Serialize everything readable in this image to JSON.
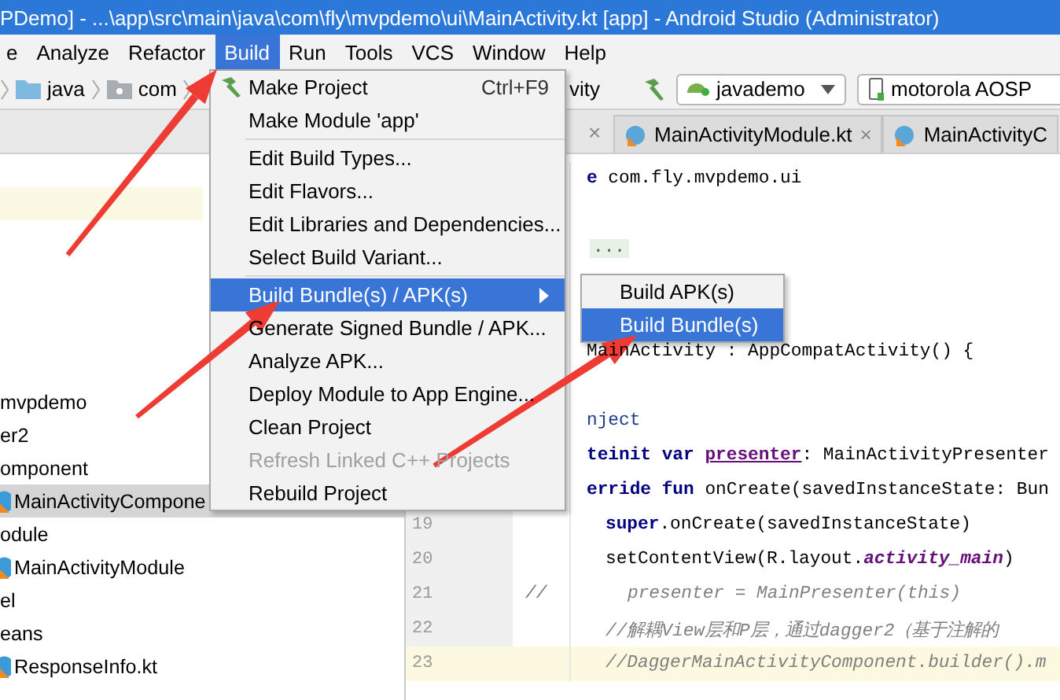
{
  "window": {
    "title": "PDemo] - ...\\app\\src\\main\\java\\com\\fly\\mvpdemo\\ui\\MainActivity.kt [app] - Android Studio (Administrator)"
  },
  "menu_bar": [
    {
      "label": "e",
      "selected": false
    },
    {
      "label": "Analyze",
      "selected": false
    },
    {
      "label": "Refactor",
      "selected": false
    },
    {
      "label": "Build",
      "selected": true
    },
    {
      "label": "Run",
      "selected": false
    },
    {
      "label": "Tools",
      "selected": false
    },
    {
      "label": "VCS",
      "selected": false
    },
    {
      "label": "Window",
      "selected": false
    },
    {
      "label": "Help",
      "selected": false
    }
  ],
  "toolbar": {
    "breadcrumbs": [
      {
        "label": "java",
        "kind": "source_folder"
      },
      {
        "label": "com",
        "kind": "package"
      }
    ],
    "breadcrumb_tail": "vity",
    "run_config": "javademo",
    "device": "motorola AOSP"
  },
  "project_tree": {
    "items": [
      {
        "label": "mvpdemo",
        "has_icon": false,
        "selected": false
      },
      {
        "label": "er2",
        "has_icon": false,
        "selected": false
      },
      {
        "label": "omponent",
        "has_icon": false,
        "selected": false
      },
      {
        "label": "MainActivityCompone",
        "has_icon": true,
        "selected": true
      },
      {
        "label": "odule",
        "has_icon": false,
        "selected": false
      },
      {
        "label": "MainActivityModule",
        "has_icon": true,
        "selected": false
      },
      {
        "label": "el",
        "has_icon": false,
        "selected": false
      },
      {
        "label": "eans",
        "has_icon": false,
        "selected": false
      },
      {
        "label": "ResponseInfo.kt",
        "has_icon": true,
        "selected": false
      }
    ]
  },
  "editor": {
    "hidden_tab_close": "×",
    "tabs": [
      {
        "label": "MainActivityModule.kt",
        "close": "×",
        "selected": false
      },
      {
        "label": "MainActivityC",
        "selected": false
      }
    ],
    "lines": [
      {
        "kind": "code",
        "highlighted": false,
        "segments": [
          {
            "text": "e ",
            "kind": "keyword"
          },
          {
            "text": "com.fly.mvpdemo.ui",
            "kind": "plain"
          }
        ]
      },
      {
        "kind": "blank",
        "highlighted": false
      },
      {
        "kind": "fold",
        "highlighted": false,
        "text": "..."
      },
      {
        "kind": "blank",
        "highlighted": false
      },
      {
        "kind": "blank",
        "highlighted": false
      },
      {
        "kind": "code",
        "highlighted": false,
        "segments": [
          {
            "text": "MainActivity : AppCompatActivity() {",
            "kind": "plain"
          }
        ]
      },
      {
        "kind": "blank",
        "highlighted": false
      },
      {
        "kind": "code",
        "highlighted": false,
        "segments": [
          {
            "text": "nject",
            "kind": "annotation"
          }
        ]
      },
      {
        "kind": "code",
        "highlighted": false,
        "segments": [
          {
            "text": "teinit var ",
            "kind": "keyword"
          },
          {
            "text": "presenter",
            "kind": "field"
          },
          {
            "text": ": MainActivityPresenter",
            "kind": "plain"
          }
        ]
      },
      {
        "kind": "code",
        "highlighted": false,
        "segments": [
          {
            "text": "erride fun ",
            "kind": "keyword"
          },
          {
            "text": "onCreate(savedInstanceState: Bun",
            "kind": "plain"
          }
        ]
      },
      {
        "kind": "code_indented",
        "number": "19",
        "highlighted": false,
        "segments": [
          {
            "text": "super",
            "kind": "keyword"
          },
          {
            "text": ".onCreate(savedInstanceState)",
            "kind": "plain"
          }
        ]
      },
      {
        "kind": "code_indented",
        "number": "20",
        "highlighted": false,
        "segments": [
          {
            "text": "setContentView(R.layout.",
            "kind": "plain"
          },
          {
            "text": "activity_main",
            "kind": "italic_field"
          },
          {
            "text": ")",
            "kind": "plain"
          }
        ]
      },
      {
        "kind": "code_indented_deep",
        "number": "21",
        "marker": "//",
        "highlighted": false,
        "segments": [
          {
            "text": "presenter = MainPresenter(this)",
            "kind": "comment"
          }
        ]
      },
      {
        "kind": "code_indented",
        "number": "22",
        "highlighted": false,
        "segments": [
          {
            "text": "//解耦View层和P层，通过dagger2（基于注解的",
            "kind": "comment"
          }
        ]
      },
      {
        "kind": "code_indented",
        "number": "23",
        "highlighted": true,
        "segments": [
          {
            "text": "//DaggerMainActivityComponent.builder().m",
            "kind": "comment"
          }
        ]
      }
    ]
  },
  "build_menu": {
    "items": [
      {
        "kind": "item",
        "label": "Make Project",
        "shortcut": "Ctrl+F9",
        "has_icon": true,
        "selected": false,
        "disabled": false,
        "has_submenu": false
      },
      {
        "kind": "item",
        "label": "Make Module 'app'",
        "has_icon": false,
        "selected": false,
        "disabled": false,
        "has_submenu": false
      },
      {
        "kind": "separator"
      },
      {
        "kind": "item",
        "label": "Edit Build Types...",
        "has_icon": false,
        "selected": false,
        "disabled": false,
        "has_submenu": false
      },
      {
        "kind": "item",
        "label": "Edit Flavors...",
        "has_icon": false,
        "selected": false,
        "disabled": false,
        "has_submenu": false
      },
      {
        "kind": "item",
        "label": "Edit Libraries and Dependencies...",
        "has_icon": false,
        "selected": false,
        "disabled": false,
        "has_submenu": false
      },
      {
        "kind": "item",
        "label": "Select Build Variant...",
        "has_icon": false,
        "selected": false,
        "disabled": false,
        "has_submenu": false
      },
      {
        "kind": "separator"
      },
      {
        "kind": "item",
        "label": "Build Bundle(s) / APK(s)",
        "has_icon": false,
        "selected": true,
        "disabled": false,
        "has_submenu": true
      },
      {
        "kind": "item",
        "label": "Generate Signed Bundle / APK...",
        "has_icon": false,
        "selected": false,
        "disabled": false,
        "has_submenu": false
      },
      {
        "kind": "item",
        "label": "Analyze APK...",
        "has_icon": false,
        "selected": false,
        "disabled": false,
        "has_submenu": false
      },
      {
        "kind": "item",
        "label": "Deploy Module to App Engine...",
        "has_icon": false,
        "selected": false,
        "disabled": false,
        "has_submenu": false
      },
      {
        "kind": "item",
        "label": "Clean Project",
        "has_icon": false,
        "selected": false,
        "disabled": false,
        "has_submenu": false
      },
      {
        "kind": "item",
        "label": "Refresh Linked C++ Projects",
        "has_icon": false,
        "selected": false,
        "disabled": true,
        "has_submenu": false
      },
      {
        "kind": "item",
        "label": "Rebuild Project",
        "has_icon": false,
        "selected": false,
        "disabled": false,
        "has_submenu": false
      }
    ]
  },
  "submenu": {
    "items": [
      {
        "label": "Build APK(s)",
        "selected": false
      },
      {
        "label": "Build Bundle(s)",
        "selected": true
      }
    ]
  },
  "annotations": [
    {
      "kind": "arrow"
    },
    {
      "kind": "arrow"
    },
    {
      "kind": "arrow"
    }
  ]
}
